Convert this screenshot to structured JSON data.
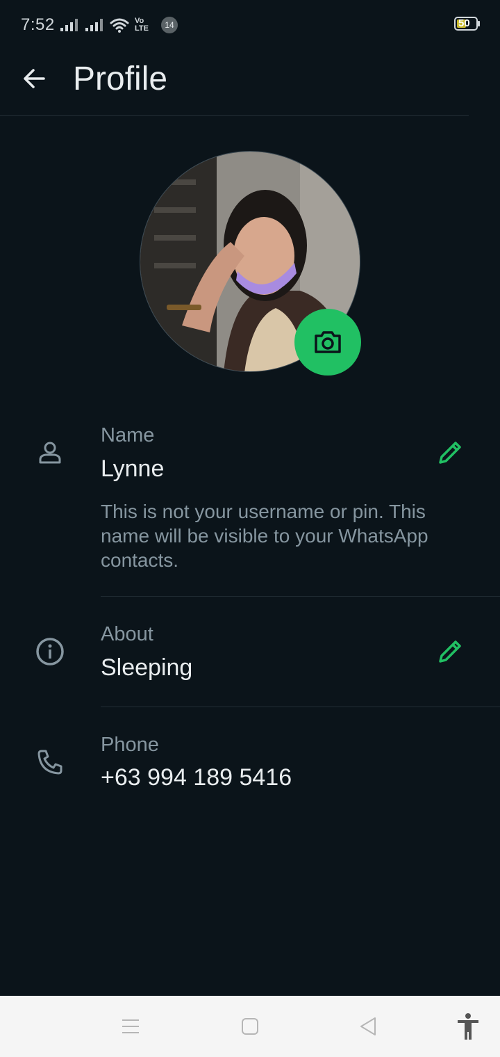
{
  "status_bar": {
    "time": "7:52",
    "volte_label": "Vo LTE",
    "notification_count": "14",
    "battery_level": "50"
  },
  "header": {
    "title": "Profile"
  },
  "profile": {
    "name": {
      "label": "Name",
      "value": "Lynne",
      "help_text": "This is not your username or pin. This name will be visible to your WhatsApp contacts."
    },
    "about": {
      "label": "About",
      "value": "Sleeping"
    },
    "phone": {
      "label": "Phone",
      "value": "+63 994 189 5416"
    }
  },
  "colors": {
    "background": "#0b141a",
    "accent": "#21c063",
    "primary_text": "#e9edef",
    "secondary_text": "#8696a0",
    "divider": "#222d34"
  },
  "icons": {
    "back": "arrow-left-icon",
    "camera": "camera-icon",
    "name": "person-icon",
    "about": "info-icon",
    "phone": "phone-icon",
    "edit": "pencil-icon"
  }
}
